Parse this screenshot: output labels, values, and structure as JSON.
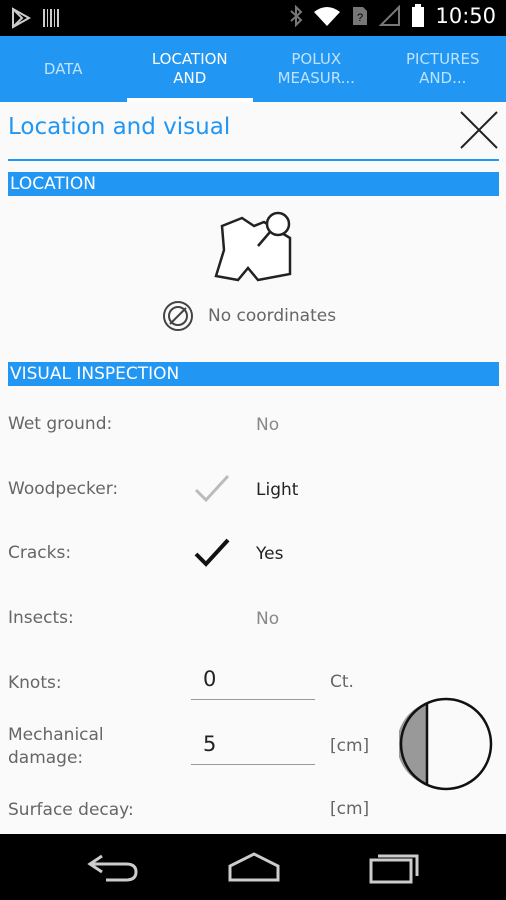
{
  "status_bar": {
    "time": "10:50"
  },
  "tabs": [
    {
      "label": "DATA",
      "active": false
    },
    {
      "label": "LOCATION AND",
      "active": true
    },
    {
      "label": "POLUX MEASUR...",
      "active": false
    },
    {
      "label": "PICTURES AND...",
      "active": false
    }
  ],
  "page": {
    "title": "Location and visual"
  },
  "location": {
    "header": "LOCATION",
    "coordinates_text": "No coordinates"
  },
  "visual": {
    "header": "VISUAL INSPECTION",
    "wet_ground": {
      "label": "Wet ground:",
      "value": "No"
    },
    "woodpecker": {
      "label": "Woodpecker:",
      "value": "Light"
    },
    "cracks": {
      "label": "Cracks:",
      "value": "Yes"
    },
    "insects": {
      "label": "Insects:",
      "value": "No"
    },
    "knots": {
      "label": "Knots:",
      "value": "0",
      "unit": "Ct."
    },
    "mechanical_damage": {
      "label": "Mechanical damage:",
      "value": "5",
      "unit": "[cm]"
    },
    "surface_decay": {
      "label": "Surface decay:",
      "unit": "[cm]"
    }
  },
  "colors": {
    "accent": "#2196f3",
    "background": "#fafafa"
  },
  "icons": [
    "play-store-icon",
    "barcode-icon",
    "bluetooth-icon",
    "wifi-icon",
    "sim-icon",
    "signal-icon",
    "battery-icon",
    "close-icon",
    "map-pin-icon",
    "no-location-icon",
    "checkmark-light-icon",
    "checkmark-icon",
    "back-icon",
    "home-icon",
    "recents-icon"
  ]
}
